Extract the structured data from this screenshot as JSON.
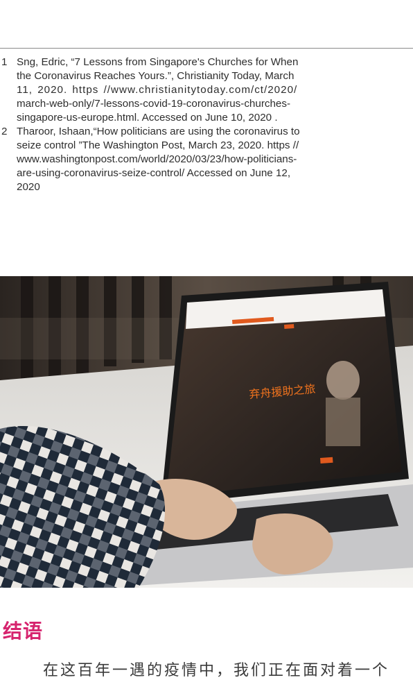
{
  "footnotes": [
    {
      "number": "1",
      "lines": [
        "Sng, Edric, “7 Lessons from Singapore's Churches for When",
        "the Coronavirus Reaches Yours.”, Christianity Today,  March",
        "11,  2020.  https //www.christianitytoday.com/ct/2020/",
        "march-web-only/7-lessons-covid-19-coronavirus-churches-",
        "singapore-us-europe.html.  Accessed on June 10, 2020 ."
      ]
    },
    {
      "number": "2",
      "lines": [
        "Tharoor, Ishaan,“How politicians are using the coronavirus to",
        "seize control ”The Washington Post, March 23, 2020. https //",
        "www.washingtonpost.com/world/2020/03/23/how-politicians-",
        "are-using-coronavirus-seize-control/  Accessed  on  June  12,",
        "2020"
      ]
    }
  ],
  "photo": {
    "description_icon": "laptop-photo",
    "screen_banner_text": "弃舟援助之旅"
  },
  "section": {
    "heading": "结语",
    "body_start": "在这百年一遇的疫情中，我们正在面对着一个"
  },
  "colors": {
    "heading": "#d6246e",
    "rule": "#8a8a8a"
  }
}
